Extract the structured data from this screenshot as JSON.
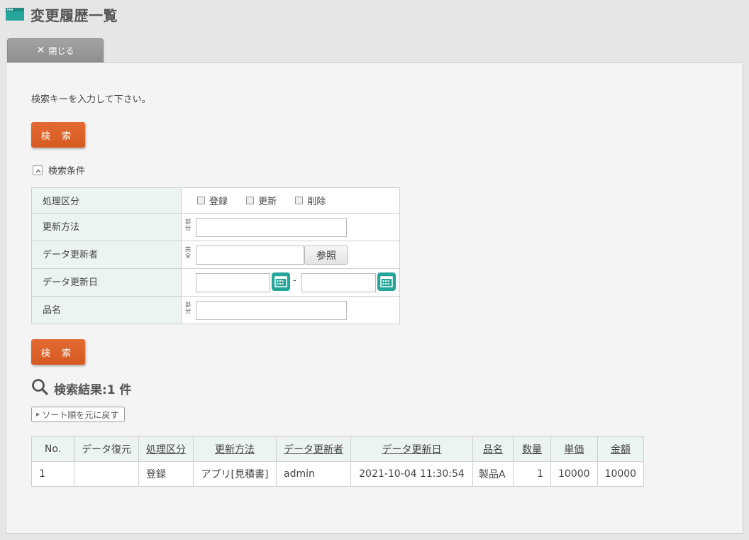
{
  "header": {
    "title": "変更履歴一覧"
  },
  "toolbar": {
    "close_label": "閉じる"
  },
  "main": {
    "instruction": "検索キーを入力して下さい。",
    "search_label": "検 索",
    "conditions_label": "検索条件",
    "conditions": {
      "process_label": "処理区分",
      "process_options": [
        "登録",
        "更新",
        "削除"
      ],
      "method_label": "更新方法",
      "method_mode": "部分",
      "updater_label": "データ更新者",
      "updater_mode": "完全",
      "reference_label": "参照",
      "date_label": "データ更新日",
      "date_separator": "-",
      "product_label": "品名",
      "product_mode": "部分"
    },
    "results_title": "検索結果:1 件",
    "sort_reset_label": "ソート順を元に戻す",
    "table": {
      "headers": [
        "No.",
        "データ復元",
        "処理区分",
        "更新方法",
        "データ更新者",
        "データ更新日",
        "品名",
        "数量",
        "単価",
        "金額"
      ],
      "rows": [
        [
          "1",
          "",
          "登録",
          "アプリ[見積書]",
          "admin",
          "2021-10-04 11:30:54",
          "製品A",
          "1",
          "10000",
          "10000"
        ]
      ]
    }
  },
  "colors": {
    "accent": "#d65b22",
    "teal": "#26a69a"
  }
}
